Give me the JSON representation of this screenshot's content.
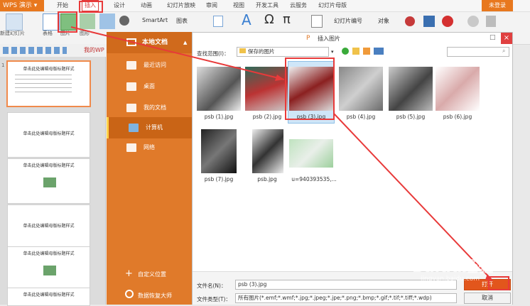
{
  "app": {
    "name": "WPS 演示",
    "login": "未登录"
  },
  "menu": [
    "开始",
    "插入",
    "设计",
    "动画",
    "幻灯片放映",
    "审阅",
    "视图",
    "开发工具",
    "云服务",
    "幻灯片母版"
  ],
  "ribbon": {
    "new_slide": "新建幻灯片",
    "table": "表格",
    "picture": "图片",
    "shape": "图形",
    "smartart": "SmartArt",
    "chart": "图表",
    "slide_number": "幻灯片编号",
    "object": "对象"
  },
  "quickbar": {
    "label": "我的WP"
  },
  "slides": [
    {
      "num": "1",
      "title": "单击此处编辑母版标题样式"
    },
    {
      "num": "",
      "title": "单击此处编辑母版标题样式"
    },
    {
      "num": "",
      "title": "单击此处编辑母版标题样式"
    },
    {
      "num": "",
      "title": "单击此处编辑母版标题样式"
    },
    {
      "num": "",
      "title": "单击此处编辑母版标题样式"
    },
    {
      "num": "",
      "title": "单击此处编辑母版标题样式"
    }
  ],
  "dialog": {
    "title": "插入图片",
    "sidebar_header": "本地文档",
    "nav": [
      "最近访问",
      "桌面",
      "我的文档",
      "计算机",
      "网络"
    ],
    "custom_location": "自定义位置",
    "recovery": "数据恢复大师",
    "lookin_label": "查找范围(I)：",
    "lookin_value": "保存的图片",
    "files": [
      "psb (1).jpg",
      "psb (2).jpg",
      "psb (3).jpg",
      "psb (4).jpg",
      "psb (5).jpg",
      "psb (6).jpg",
      "psb (7).jpg",
      "psb.jpg",
      "u=940393535,..."
    ],
    "filename_label": "文件名(N)：",
    "filename_value": "psb (3).jpg",
    "filetype_label": "文件类型(T)：",
    "filetype_value": "所有图片(*.emf;*.wmf;*.jpg;*.jpeg;*.jpe;*.png;*.bmp;*.gif;*.tif;*.tiff;*.wdp)",
    "open_label": "打开",
    "cancel_label": "取消"
  },
  "watermark": {
    "text": "Baidu经验",
    "sub": "jingyan.baidu.com"
  },
  "colors": {
    "accent": "#e8781e",
    "highlight": "#e83a3a"
  }
}
